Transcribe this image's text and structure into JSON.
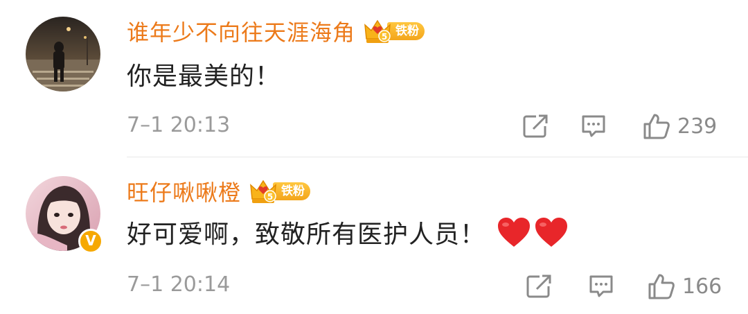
{
  "comments": [
    {
      "username": "谁年少不向往天涯海角",
      "fan_badge_label": "铁粉",
      "fan_badge_level": "5",
      "text": "你是最美的！",
      "timestamp": "7–1 20:13",
      "likes": "239",
      "verified": false,
      "emoji": []
    },
    {
      "username": "旺仔啾啾橙",
      "fan_badge_label": "铁粉",
      "fan_badge_level": "5",
      "text": "好可爱啊，致敬所有医护人员！",
      "timestamp": "7–1 20:14",
      "likes": "166",
      "verified": true,
      "verified_glyph": "V",
      "emoji": [
        "red-heart",
        "red-heart"
      ]
    }
  ],
  "icons": {
    "share": "share-icon",
    "comment": "comment-icon",
    "like": "thumbs-up-icon"
  },
  "colors": {
    "username": "#ec7a1a",
    "badge": "#f6a800",
    "meta": "#9a9a9a",
    "heart": "#e8262a"
  }
}
